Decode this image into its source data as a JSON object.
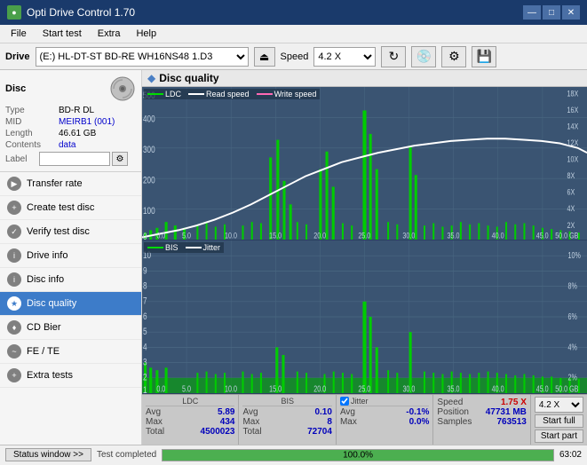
{
  "titleBar": {
    "title": "Opti Drive Control 1.70",
    "icon": "●",
    "minimizeBtn": "—",
    "maximizeBtn": "□",
    "closeBtn": "✕"
  },
  "menuBar": {
    "items": [
      "File",
      "Start test",
      "Extra",
      "Help"
    ]
  },
  "driveBar": {
    "label": "Drive",
    "driveValue": "(E:)  HL-DT-ST BD-RE  WH16NS48 1.D3",
    "speedLabel": "Speed",
    "speedValue": "4.2 X"
  },
  "sidebar": {
    "discTitle": "Disc",
    "fields": [
      {
        "label": "Type",
        "value": "BD-R DL"
      },
      {
        "label": "MID",
        "value": "MEIRB1 (001)"
      },
      {
        "label": "Length",
        "value": "46.61 GB"
      },
      {
        "label": "Contents",
        "value": "data"
      }
    ],
    "labelField": "Label",
    "navItems": [
      {
        "id": "transfer-rate",
        "label": "Transfer rate",
        "active": false
      },
      {
        "id": "create-test-disc",
        "label": "Create test disc",
        "active": false
      },
      {
        "id": "verify-test-disc",
        "label": "Verify test disc",
        "active": false
      },
      {
        "id": "drive-info",
        "label": "Drive info",
        "active": false
      },
      {
        "id": "disc-info",
        "label": "Disc info",
        "active": false
      },
      {
        "id": "disc-quality",
        "label": "Disc quality",
        "active": true
      },
      {
        "id": "cd-bier",
        "label": "CD Bier",
        "active": false
      },
      {
        "id": "fe-te",
        "label": "FE / TE",
        "active": false
      },
      {
        "id": "extra-tests",
        "label": "Extra tests",
        "active": false
      }
    ]
  },
  "rightPanel": {
    "title": "Disc quality",
    "chart1": {
      "legend": [
        {
          "label": "LDC",
          "color": "#00cc00"
        },
        {
          "label": "Read speed",
          "color": "#ffffff"
        },
        {
          "label": "Write speed",
          "color": "#ff69b4"
        }
      ],
      "yAxisMax": 500,
      "yAxisLabels": [
        "500",
        "400",
        "300",
        "200",
        "100",
        "0"
      ],
      "yAxisRight": [
        "18X",
        "16X",
        "14X",
        "12X",
        "10X",
        "8X",
        "6X",
        "4X",
        "2X"
      ],
      "xAxisLabels": [
        "0.0",
        "5.0",
        "10.0",
        "15.0",
        "20.0",
        "25.0",
        "30.0",
        "35.0",
        "40.0",
        "45.0",
        "50.0 GB"
      ]
    },
    "chart2": {
      "legend": [
        {
          "label": "BIS",
          "color": "#00cc00"
        },
        {
          "label": "Jitter",
          "color": "#ffffff"
        }
      ],
      "yAxisMax": 10,
      "yAxisLabels": [
        "10",
        "9",
        "8",
        "7",
        "6",
        "5",
        "4",
        "3",
        "2",
        "1"
      ],
      "yAxisRight": [
        "10%",
        "8%",
        "6%",
        "4%",
        "2%"
      ],
      "xAxisLabels": [
        "0.0",
        "5.0",
        "10.0",
        "15.0",
        "20.0",
        "25.0",
        "30.0",
        "35.0",
        "40.0",
        "45.0",
        "50.0 GB"
      ]
    },
    "stats": {
      "columns": [
        "LDC",
        "BIS",
        "",
        "Jitter"
      ],
      "avg": {
        "ldc": "5.89",
        "bis": "0.10",
        "jitter": "-0.1%"
      },
      "max": {
        "ldc": "434",
        "bis": "8",
        "jitter": "0.0%"
      },
      "total": {
        "ldc": "4500023",
        "bis": "72704"
      },
      "jitterChecked": true,
      "speed": {
        "label": "Speed",
        "value": "1.75 X"
      },
      "position": {
        "label": "Position",
        "value": "47731 MB"
      },
      "samples": {
        "label": "Samples",
        "value": "763513"
      },
      "speedSelect": "4.2 X",
      "startFullBtn": "Start full",
      "startPartBtn": "Start part"
    }
  },
  "statusBar": {
    "windowBtn": "Status window >>",
    "statusText": "Test completed",
    "progress": 100,
    "progressText": "100.0%",
    "time": "63:02"
  }
}
